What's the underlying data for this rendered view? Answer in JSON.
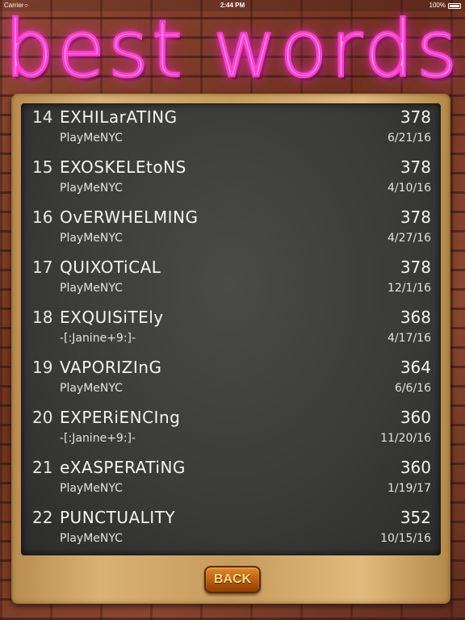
{
  "status_bar": {
    "carrier": "Carrier",
    "time": "2:44 PM",
    "battery": "100%"
  },
  "title": "best words",
  "colors": {
    "neon": "#ff3fd0",
    "board": "#3a3a39",
    "frame": "#d9b173",
    "button": "#b85c10"
  },
  "rows": [
    {
      "rank": "14",
      "word": "EXHILarATING",
      "score": "378",
      "player": "PlayMeNYC",
      "date": "6/21/16"
    },
    {
      "rank": "15",
      "word": "EXOSKELEtoNS",
      "score": "378",
      "player": "PlayMeNYC",
      "date": "4/10/16"
    },
    {
      "rank": "16",
      "word": "OvERWHELMING",
      "score": "378",
      "player": "PlayMeNYC",
      "date": "4/27/16"
    },
    {
      "rank": "17",
      "word": "QUIXOTiCAL",
      "score": "378",
      "player": "PlayMeNYC",
      "date": "12/1/16"
    },
    {
      "rank": "18",
      "word": "EXQUISiTEly",
      "score": "368",
      "player": "-[:Janine+9:]-",
      "date": "4/17/16"
    },
    {
      "rank": "19",
      "word": "VAPORIZInG",
      "score": "364",
      "player": "PlayMeNYC",
      "date": "6/6/16"
    },
    {
      "rank": "20",
      "word": "EXPERiENCIng",
      "score": "360",
      "player": "-[:Janine+9:]-",
      "date": "11/20/16"
    },
    {
      "rank": "21",
      "word": "eXASPERATiNG",
      "score": "360",
      "player": "PlayMeNYC",
      "date": "1/19/17"
    },
    {
      "rank": "22",
      "word": "PUNCTUALITY",
      "score": "352",
      "player": "PlayMeNYC",
      "date": "10/15/16"
    }
  ],
  "back_button": "BACK"
}
